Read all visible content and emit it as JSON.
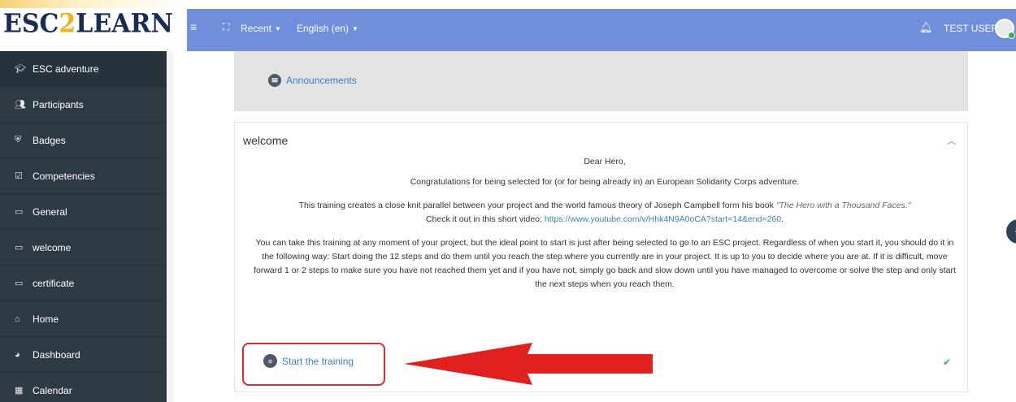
{
  "logo": {
    "part1": "ESC",
    "part2": "2",
    "part3": "LEARN"
  },
  "topbar": {
    "recent_label": "Recent",
    "language_label": "English (en)",
    "user_name": "TEST USER"
  },
  "sidebar": {
    "items": [
      {
        "label": "ESC adventure",
        "icon": "graduation-cap-icon"
      },
      {
        "label": "Participants",
        "icon": "users-icon"
      },
      {
        "label": "Badges",
        "icon": "shield-icon"
      },
      {
        "label": "Competencies",
        "icon": "check-square-icon"
      },
      {
        "label": "General",
        "icon": "folder-icon"
      },
      {
        "label": "welcome",
        "icon": "folder-icon"
      },
      {
        "label": "certificate",
        "icon": "folder-icon"
      },
      {
        "label": "Home",
        "icon": "home-icon"
      },
      {
        "label": "Dashboard",
        "icon": "dashboard-icon"
      },
      {
        "label": "Calendar",
        "icon": "calendar-icon"
      }
    ]
  },
  "main": {
    "announcements_label": "Announcements",
    "section_title": "welcome",
    "greeting": "Dear Hero,",
    "congrats": "Congratulations for being selected for (or for being already in) an European Solidarity Corps adventure.",
    "intro_text": "This training creates a close knit parallel between your project and the world famous theory of Joseph Campbell form his book",
    "book_title": "\"The Hero with a Thousand Faces.\"",
    "video_prefix": "Check it out in this short video:",
    "video_url": "https://www.youtube.com/v/Hhk4N9A0oCA?start=14&end=260",
    "video_suffix": ".",
    "instructions": "You can take this training at any moment of your project, but the ideal point to start is just after being selected to go to an ESC project. Regardless of when you start it, you should do it in the following way: Start doing the 12 steps and do them until you reach the step where you currently are in your project. It is up to you to decide where you are at. If it is difficult, move forward 1 or 2 steps to make sure you have not reached them yet and if you have not, simply go back and slow down until you have managed to overcome or solve the step and only start the next steps when you reach them.",
    "start_training_label": "Start the training"
  },
  "colors": {
    "topbar": "#6f8fda",
    "sidebar": "#2e3a42",
    "link": "#3a7fc4",
    "annotation_red": "#e0201e",
    "check_green": "#3cb043"
  }
}
